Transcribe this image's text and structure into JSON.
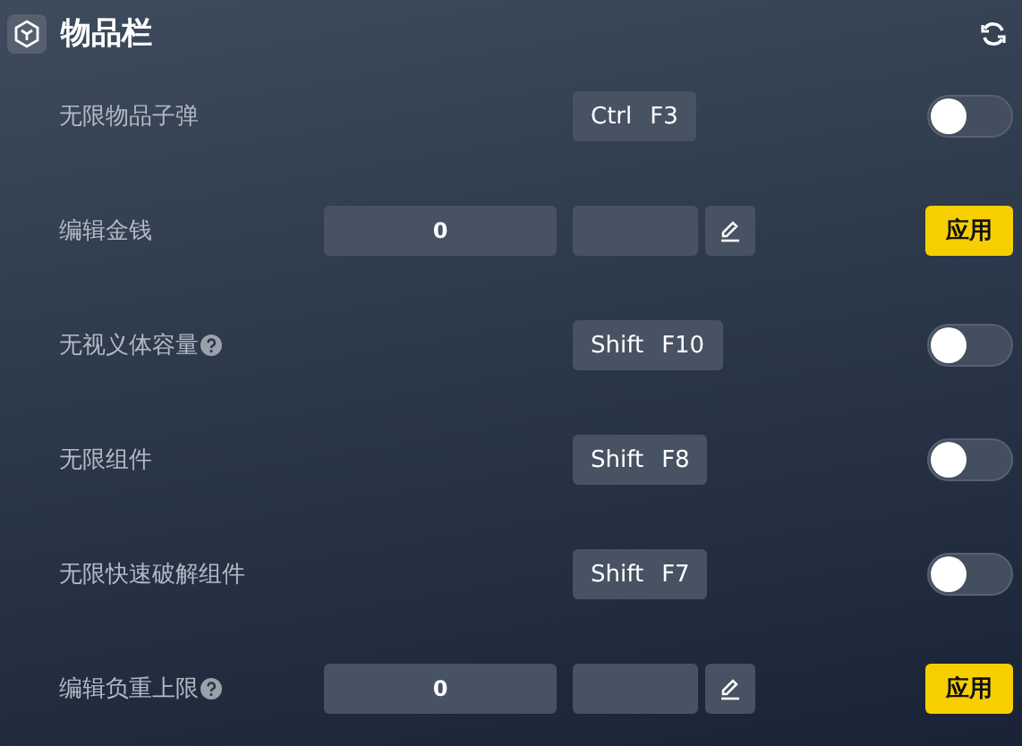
{
  "title": "物品栏",
  "rows": [
    {
      "kind": "toggle",
      "label": "无限物品子弹",
      "help": false,
      "keys": [
        "Ctrl",
        "F3"
      ],
      "on": false
    },
    {
      "kind": "edit",
      "label": "编辑金钱",
      "help": false,
      "value": "0",
      "button": "应用"
    },
    {
      "kind": "toggle",
      "label": "无视义体容量",
      "help": true,
      "keys": [
        "Shift",
        "F10"
      ],
      "on": false
    },
    {
      "kind": "toggle",
      "label": "无限组件",
      "help": false,
      "keys": [
        "Shift",
        "F8"
      ],
      "on": false
    },
    {
      "kind": "toggle",
      "label": "无限快速破解组件",
      "help": false,
      "keys": [
        "Shift",
        "F7"
      ],
      "on": false
    },
    {
      "kind": "edit",
      "label": "编辑负重上限",
      "help": true,
      "value": "0",
      "button": "应用"
    }
  ]
}
